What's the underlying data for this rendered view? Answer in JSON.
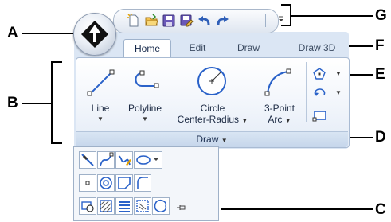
{
  "callouts": {
    "a": "A",
    "b": "B",
    "c": "C",
    "d": "D",
    "e": "E",
    "f": "F",
    "g": "G"
  },
  "application_button": {
    "icon": "application-logo-icon"
  },
  "quick_access_toolbar": {
    "icons": [
      "new-icon",
      "open-icon",
      "save-icon",
      "save-as-icon",
      "undo-icon",
      "redo-icon"
    ],
    "overflow_icon": "chevron-down-icon"
  },
  "ribbon": {
    "tabs": [
      {
        "label": "Home",
        "active": true
      },
      {
        "label": "Edit"
      },
      {
        "label": "Draw"
      },
      {
        "label": "Draw 3D"
      }
    ],
    "panel": {
      "title": "Draw",
      "tools": [
        {
          "label": "Line"
        },
        {
          "label": "Polyline"
        },
        {
          "label_line1": "Circle",
          "label_line2": "Center-Radius"
        },
        {
          "label_line1": "3-Point",
          "label_line2": "Arc"
        }
      ],
      "small_tools": [
        "polygon-icon",
        "rotate-icon",
        "rectangle-icon"
      ]
    }
  },
  "flyout": {
    "rows": [
      [
        "ray-icon",
        "spline-icon",
        "freehand-icon",
        "ellipse-icon"
      ],
      [
        "point-icon",
        "donut-icon",
        "boundary-icon",
        "fillet-arc-icon"
      ],
      [
        "region-icon",
        "hatch-icon",
        "wipeout-icon",
        "revision-cloud-icon",
        "shape-icon"
      ]
    ],
    "pin_icon": "pin-icon"
  },
  "colors": {
    "ribbon_bg": "#dbe6f4",
    "accent": "#15284a"
  }
}
